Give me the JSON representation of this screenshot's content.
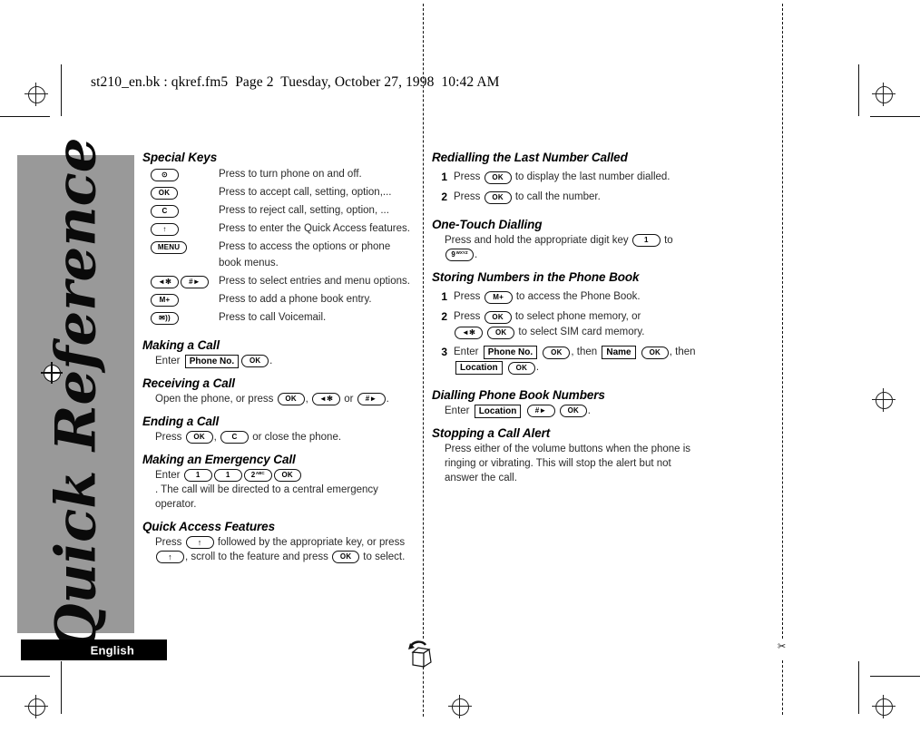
{
  "document": {
    "header": "st210_en.bk : qkref.fm5  Page 2  Tuesday, October 27, 1998  10:42 AM",
    "sidebar_title": "Quick Reference",
    "language_badge": "English",
    "sidebar_color": "#999999"
  },
  "left_column": {
    "special_keys": {
      "heading": "Special Keys",
      "rows": [
        {
          "keys": [
            {
              "label": "⊙",
              "type": "power-key"
            }
          ],
          "desc": "Press to turn phone on and off."
        },
        {
          "keys": [
            {
              "label": "OK",
              "type": "ok-key"
            }
          ],
          "desc": "Press to accept call, setting, option,..."
        },
        {
          "keys": [
            {
              "label": "C",
              "type": "clear-key"
            }
          ],
          "desc": "Press to reject call, setting, option, ..."
        },
        {
          "keys": [
            {
              "label": "↑",
              "type": "up-key"
            }
          ],
          "desc": "Press to enter the Quick Access features."
        },
        {
          "keys": [
            {
              "label": "MENU",
              "type": "menu-key"
            }
          ],
          "desc": "Press to access the options or phone book menus."
        },
        {
          "keys": [
            {
              "label": "◄✻",
              "type": "star-key"
            },
            {
              "label": "#►",
              "type": "hash-key"
            }
          ],
          "desc": "Press to select entries and menu options."
        },
        {
          "keys": [
            {
              "label": "M+",
              "type": "memory-key"
            }
          ],
          "desc": "Press to add a phone book entry."
        },
        {
          "keys": [
            {
              "label": "✉))",
              "type": "voicemail-key"
            }
          ],
          "desc": "Press to call Voicemail."
        }
      ]
    },
    "making_a_call": {
      "heading": "Making a Call",
      "text_1": "Enter",
      "field": "Phone No.",
      "key_ok": "OK",
      "text_2": "."
    },
    "receiving_a_call": {
      "heading": "Receiving a Call",
      "text_1": "Open the phone, or press",
      "key_ok": "OK",
      "text_2": ",",
      "key_star": "◄✻",
      "text_3": "or",
      "key_hash": "#►",
      "text_4": "."
    },
    "ending_a_call": {
      "heading": "Ending a Call",
      "text_1": "Press",
      "key_ok": "OK",
      "text_2": ",",
      "key_c": "C",
      "text_3": "or close the phone."
    },
    "emergency_call": {
      "heading": "Making an Emergency Call",
      "text_1": "Enter",
      "key_1a": "1",
      "key_1b": "1",
      "key_2": "2",
      "key_2_sup": "ABC",
      "key_ok": "OK",
      "text_2": ".  The call will be directed to a central emergency operator."
    },
    "quick_access": {
      "heading": "Quick Access Features",
      "text_1": "Press",
      "key_up_1": "↑",
      "text_2": "followed by the appropriate key, or press",
      "key_up_2": "↑",
      "text_3": ", scroll to the feature and press",
      "key_ok": "OK",
      "text_4": "to select."
    }
  },
  "right_column": {
    "redialling": {
      "heading": "Redialling the Last Number Called",
      "steps": [
        {
          "num": "1",
          "text_1": "Press",
          "key": "OK",
          "text_2": "to display the last number dialled."
        },
        {
          "num": "2",
          "text_1": "Press",
          "key": "OK",
          "text_2": "to call the number."
        }
      ]
    },
    "one_touch": {
      "heading": "One-Touch Dialling",
      "text_1": "Press and hold the appropriate digit key",
      "key_1": "1",
      "text_2": "to",
      "key_9": "9",
      "key_9_sup": "WXYZ",
      "text_3": "."
    },
    "storing_numbers": {
      "heading": "Storing Numbers in the Phone Book",
      "step1": {
        "num": "1",
        "text_1": "Press",
        "key": "M+",
        "text_2": "to access the Phone Book."
      },
      "step2": {
        "num": "2",
        "text_1": "Press",
        "key_ok_a": "OK",
        "text_2": "to select phone memory, or",
        "key_star": "◄✻",
        "key_ok_b": "OK",
        "text_3": "to select SIM card memory."
      },
      "step3": {
        "num": "3",
        "text_1": "Enter",
        "field_phone": "Phone No.",
        "key_ok_a": "OK",
        "text_2": ", then",
        "field_name": "Name",
        "key_ok_b": "OK",
        "text_3": ", then",
        "field_location": "Location",
        "key_ok_c": "OK",
        "text_4": "."
      }
    },
    "dialling_phone_book": {
      "heading": "Dialling Phone Book Numbers",
      "text_1": "Enter",
      "field_location": "Location",
      "key_hash": "#►",
      "key_ok": "OK",
      "text_2": "."
    },
    "stopping_alert": {
      "heading": "Stopping a Call Alert",
      "body": "Press either of the volume buttons when the phone is ringing or vibrating. This will stop the alert but not answer the call."
    }
  },
  "print_marks": {
    "scissors": "✂"
  }
}
